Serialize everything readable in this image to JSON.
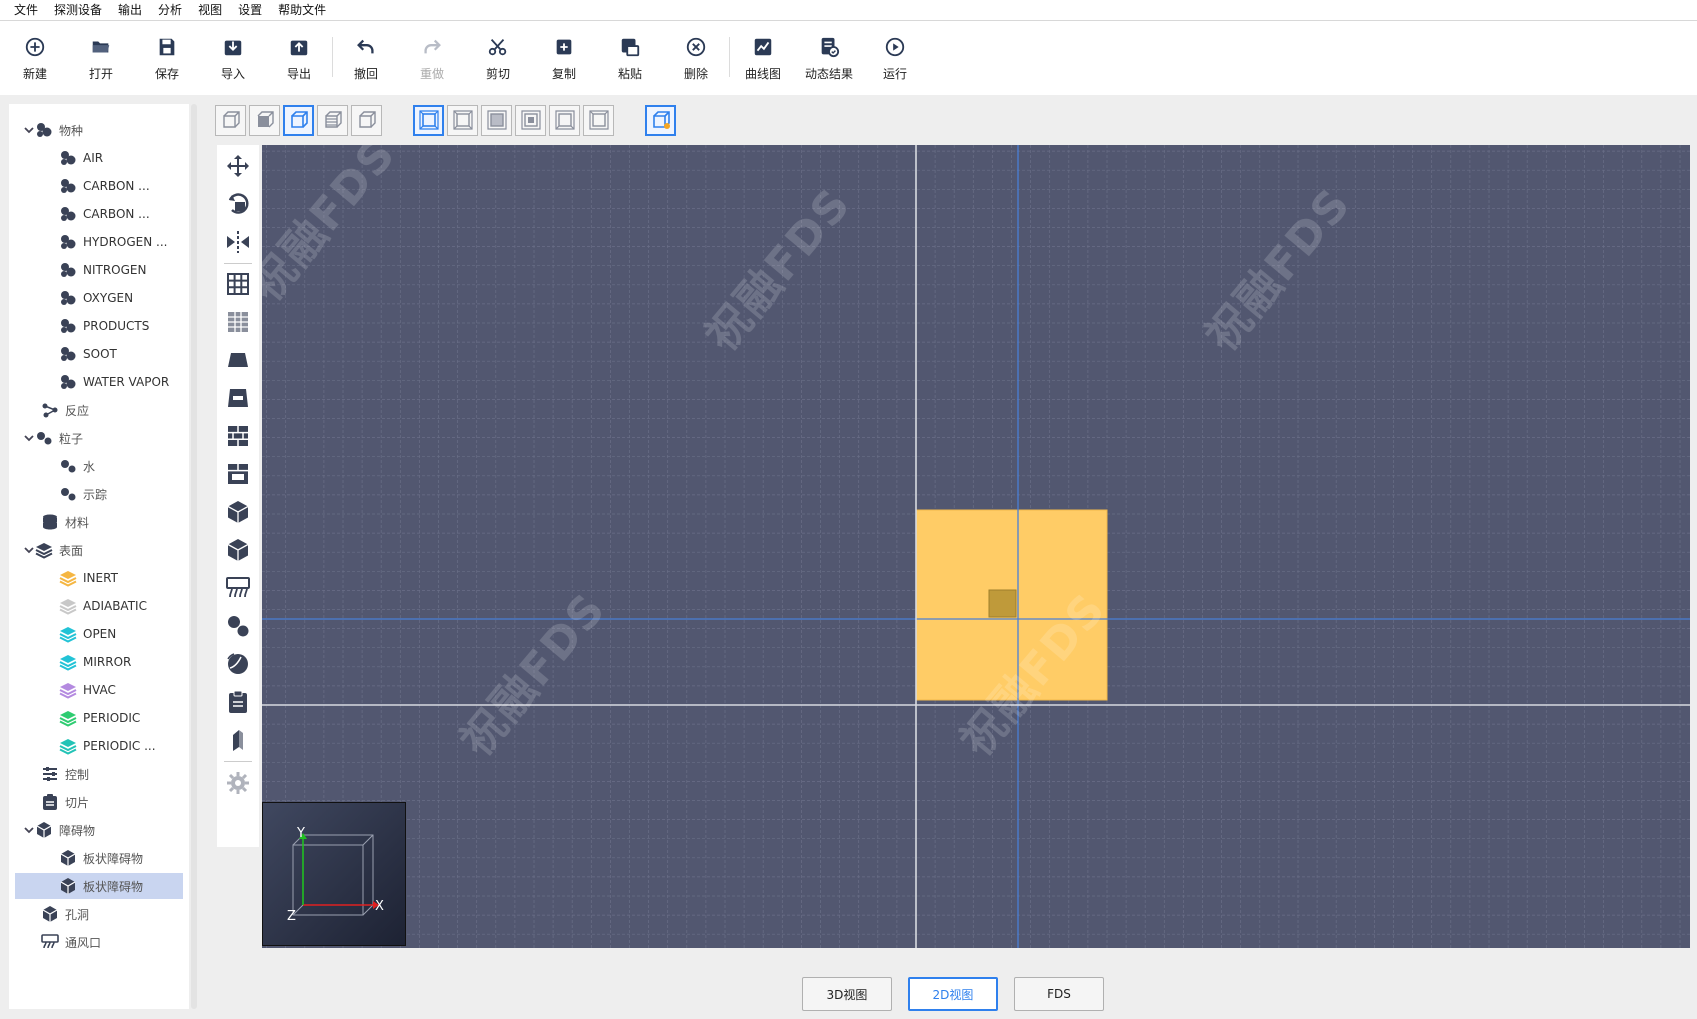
{
  "menu": [
    "文件",
    "探测设备",
    "输出",
    "分析",
    "视图",
    "设置",
    "帮助文件"
  ],
  "toolbar": {
    "new": "新建",
    "open": "打开",
    "save": "保存",
    "import": "导入",
    "export": "导出",
    "undo": "撤回",
    "redo": "重做",
    "cut": "剪切",
    "copy": "复制",
    "paste": "粘贴",
    "delete": "删除",
    "curve": "曲线图",
    "dynamic": "动态结果",
    "run": "运行"
  },
  "tree": {
    "species": "物种",
    "species_items": [
      "AIR",
      "CARBON ...",
      "CARBON ...",
      "HYDROGEN ...",
      "NITROGEN",
      "OXYGEN",
      "PRODUCTS",
      "SOOT",
      "WATER VAPOR"
    ],
    "reaction": "反应",
    "particles": "粒子",
    "particle_items": [
      "水",
      "示踪"
    ],
    "materials": "材料",
    "surfaces": "表面",
    "surface_items": [
      "INERT",
      "ADIABATIC",
      "OPEN",
      "MIRROR",
      "HVAC",
      "PERIODIC",
      "PERIODIC ..."
    ],
    "controls": "控制",
    "slices": "切片",
    "obstructions": "障碍物",
    "obstruction_items": [
      "板状障碍物",
      "板状障碍物"
    ],
    "holes": "孔洞",
    "vents": "通风口"
  },
  "colors": {
    "canvas_bg": "#525770",
    "grid": "#6a6f87",
    "obstruction_fill": "#ffcc66",
    "accent": "#2f80ed",
    "inert": "#f5b642",
    "adiabatic": "#c8c8c8",
    "open": "#22c3d6",
    "mirror": "#22c3d6",
    "hvac": "#b48ae0",
    "periodic": "#2ecc71"
  },
  "canvas": {
    "watermark": "祝融FDS"
  },
  "axes": {
    "x": "X",
    "y": "Y",
    "z": "Z"
  },
  "tabs": {
    "view3d": "3D视图",
    "view2d": "2D视图",
    "fds": "FDS"
  }
}
